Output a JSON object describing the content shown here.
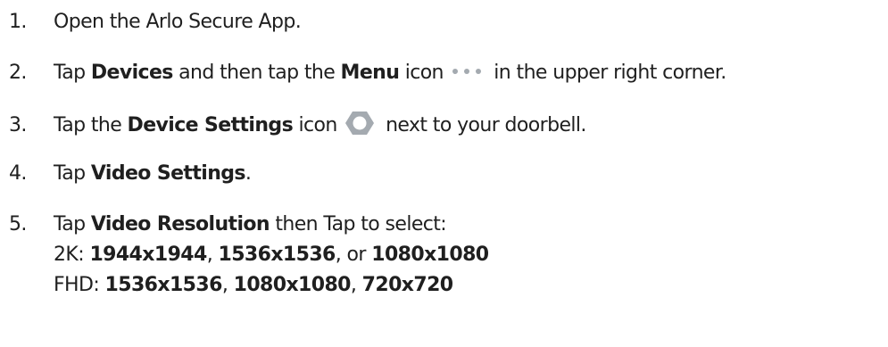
{
  "steps": [
    {
      "number": "1.",
      "text": "Open the Arlo Secure App."
    },
    {
      "number": "2.",
      "pre": "Tap ",
      "b1": "Devices",
      "mid": " and then tap the ",
      "b2": "Menu",
      "post1": " icon",
      "icon": "more-dots-icon",
      "post2": " in the  upper right corner."
    },
    {
      "number": "3.",
      "pre": "Tap the ",
      "b1": "Device Settings",
      "post1": " icon",
      "icon": "gear-icon",
      "post2": " next to your doorbell."
    },
    {
      "number": "4.",
      "pre": "Tap ",
      "b1": "Video Settings",
      "post": "."
    },
    {
      "number": "5.",
      "pre": "Tap ",
      "b1": "Video Resolution",
      "post": " then Tap to select:",
      "options": [
        {
          "label": "2K: ",
          "r1": "1944x1944",
          "sep1": ", ",
          "r2": "1536x1536",
          "sep2": ", or ",
          "r3": "1080x1080"
        },
        {
          "label": "FHD: ",
          "r1": "1536x1536",
          "sep1": ", ",
          "r2": "1080x1080",
          "sep2": ", ",
          "r3": "720x720"
        }
      ]
    }
  ],
  "colors": {
    "text": "#1f1f1f",
    "icon": "#a4aab0"
  }
}
